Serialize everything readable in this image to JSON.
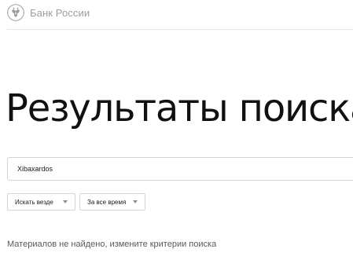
{
  "header": {
    "logo_text": "Банк России",
    "logo_icon": "double-headed-eagle-emblem"
  },
  "main": {
    "title": "Результаты поиска",
    "search": {
      "value": "Xibaxardos"
    },
    "filters": {
      "scope": {
        "selected": "Искать везде",
        "icon": "chevron-down-icon"
      },
      "period": {
        "selected": "За все время",
        "icon": "chevron-down-icon"
      }
    },
    "message": "Материалов не найдено, измените критерии поиска"
  },
  "colors": {
    "text": "#111111",
    "muted": "#9a9da3",
    "border": "#d3d5d9",
    "message": "#555a61"
  }
}
